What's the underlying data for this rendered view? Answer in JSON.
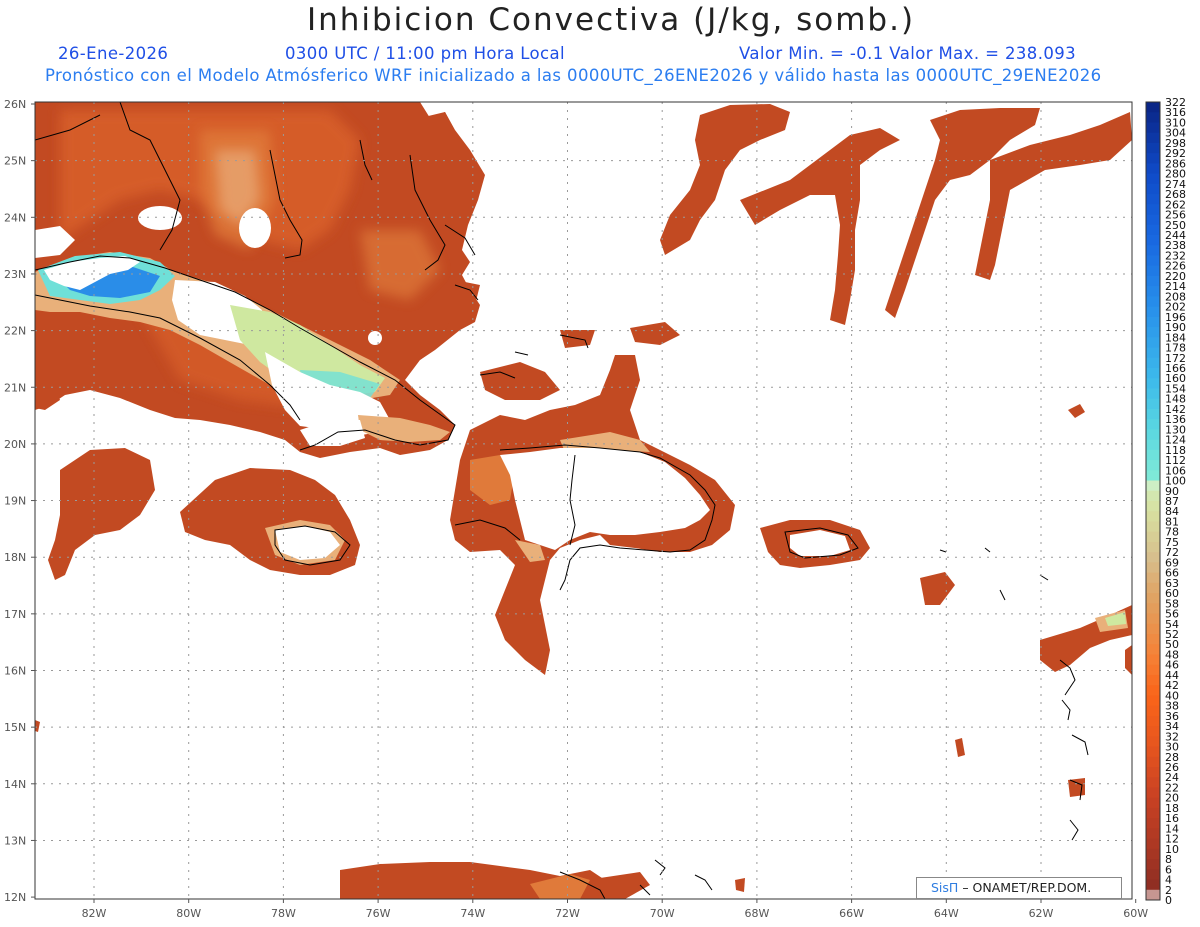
{
  "header": {
    "title": "Inhibicion Convectiva (J/kg, somb.)",
    "date": "26-Ene-2026",
    "time": "0300 UTC / 11:00 pm Hora Local",
    "minmax": "Valor Min. = -0.1  Valor Max. = 238.093",
    "forecast": "Pronóstico con el Modelo Atmósferico WRF inicializado a las 0000UTC_26ENE2026 y válido hasta las  0000UTC_29ENE2026"
  },
  "axes": {
    "lat_labels": [
      "26N",
      "25N",
      "24N",
      "23N",
      "22N",
      "21N",
      "20N",
      "19N",
      "18N",
      "17N",
      "16N",
      "15N",
      "14N",
      "13N",
      "12N"
    ],
    "lon_labels": [
      "82W",
      "80W",
      "78W",
      "76W",
      "74W",
      "72W",
      "70W",
      "68W",
      "66W",
      "64W",
      "62W",
      "60W"
    ]
  },
  "colorbar": {
    "labels": [
      "322",
      "316",
      "310",
      "304",
      "298",
      "292",
      "286",
      "280",
      "274",
      "268",
      "262",
      "256",
      "250",
      "244",
      "238",
      "232",
      "226",
      "220",
      "214",
      "208",
      "202",
      "196",
      "190",
      "184",
      "178",
      "172",
      "166",
      "160",
      "154",
      "148",
      "142",
      "136",
      "130",
      "124",
      "118",
      "112",
      "106",
      "100",
      "90",
      "87",
      "84",
      "81",
      "78",
      "75",
      "72",
      "69",
      "66",
      "63",
      "60",
      "58",
      "56",
      "54",
      "52",
      "50",
      "48",
      "46",
      "44",
      "42",
      "40",
      "38",
      "36",
      "34",
      "32",
      "30",
      "28",
      "26",
      "24",
      "22",
      "20",
      "18",
      "16",
      "14",
      "12",
      "10",
      "8",
      "6",
      "4",
      "2",
      "0"
    ]
  },
  "credit": {
    "logo": "SisΠ",
    "text": "– ONAMET/REP.DOM."
  },
  "colors": {
    "shade_dark": "#a8391c",
    "shade_mid": "#c4481f",
    "shade_orange": "#e46a2a",
    "shade_tan": "#e9b07a",
    "shade_green": "#cfe8a0",
    "shade_cyan": "#6fe0d8",
    "shade_blue": "#2a8de8",
    "coast": "#000000",
    "grid": "#9a9a9a"
  }
}
